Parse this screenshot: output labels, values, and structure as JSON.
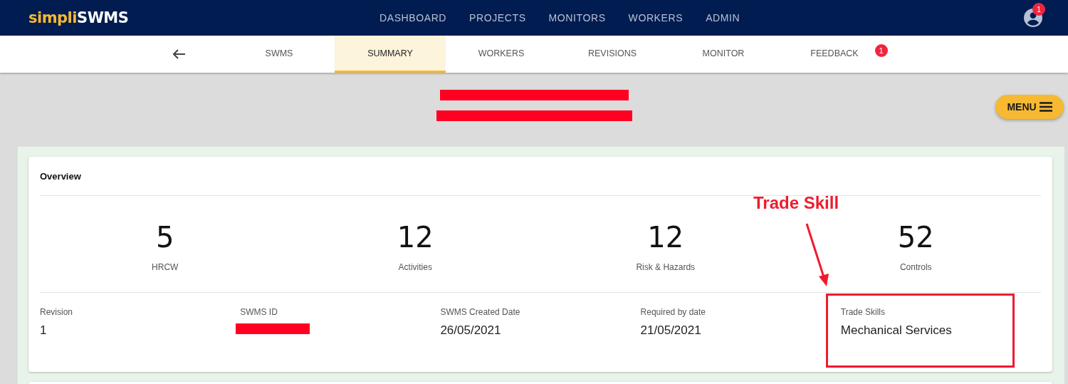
{
  "brand": {
    "part_1": "simpli",
    "part_2": "SWMS"
  },
  "nav": [
    "DASHBOARD",
    "PROJECTS",
    "MONITORS",
    "WORKERS",
    "ADMIN"
  ],
  "account": {
    "badge": "1"
  },
  "tabs": [
    {
      "label": "SWMS",
      "selected": false
    },
    {
      "label": "SUMMARY",
      "selected": true
    },
    {
      "label": "WORKERS",
      "selected": false
    },
    {
      "label": "REVISIONS",
      "selected": false
    },
    {
      "label": "MONITOR",
      "selected": false
    },
    {
      "label": "FEEDBACK",
      "selected": false,
      "badge": "1"
    }
  ],
  "menu_button": "MENU",
  "overview": {
    "title": "Overview",
    "stats": [
      {
        "value": "5",
        "label": "HRCW"
      },
      {
        "value": "12",
        "label": "Activities"
      },
      {
        "value": "12",
        "label": "Risk & Hazards"
      },
      {
        "value": "52",
        "label": "Controls"
      }
    ],
    "details": [
      {
        "label": "Revision",
        "value": "1",
        "redacted": false
      },
      {
        "label": "SWMS ID",
        "redacted": true
      },
      {
        "label": "SWMS Created Date",
        "value": "26/05/2021",
        "redacted": false
      },
      {
        "label": "Required by date",
        "value": "21/05/2021",
        "redacted": false
      },
      {
        "label": "Trade Skills",
        "value": "Mechanical Services",
        "redacted": false
      }
    ]
  },
  "annotation": {
    "label": "Trade Skill"
  }
}
